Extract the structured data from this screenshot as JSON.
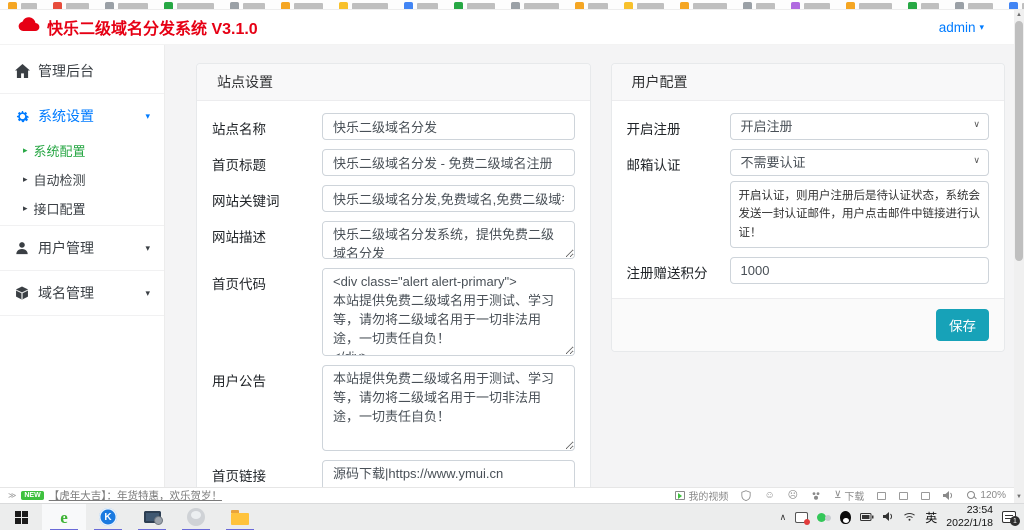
{
  "header": {
    "title": "快乐二级域名分发系统 V3.1.0",
    "user_menu": "admin"
  },
  "sidebar": {
    "home": "管理后台",
    "system_settings": "系统设置",
    "system_submenu": [
      "系统配置",
      "自动检测",
      "接口配置"
    ],
    "user_management": "用户管理",
    "domain_management": "域名管理"
  },
  "site_panel": {
    "title": "站点设置",
    "site_name_label": "站点名称",
    "site_name_value": "快乐二级域名分发",
    "home_title_label": "首页标题",
    "home_title_value": "快乐二级域名分发 - 免费二级域名注册",
    "keywords_label": "网站关键词",
    "keywords_value": "快乐二级域名分发,免费域名,免费二级域名,免费备案域名",
    "description_label": "网站描述",
    "description_value": "快乐二级域名分发系统，提供免费二级域名分发",
    "home_code_label": "首页代码",
    "home_code_value": "<div class=\"alert alert-primary\">\n本站提供免费二级域名用于测试、学习等，请勿将二级域名用于一切非法用途，一切责任自负！\n</div>",
    "notice_label": "用户公告",
    "notice_value": "本站提供免费二级域名用于测试、学习等，请勿将二级域名用于一切非法用途，一切责任自负！",
    "links_label": "首页链接",
    "links_value": "源码下载|https://www.ymui.cn"
  },
  "user_panel": {
    "title": "用户配置",
    "register_label": "开启注册",
    "register_value": "开启注册",
    "email_auth_label": "邮箱认证",
    "email_auth_value": "不需要认证",
    "email_auth_help": "开启认证，则用户注册后是待认证状态，系统会发送一封认证邮件，用户点击邮件中链接进行认证！",
    "points_label": "注册赠送积分",
    "points_value": "1000",
    "save_label": "保存"
  },
  "status_bar": {
    "badge": "NEW",
    "notice": "【虎年大吉】：年货特惠，欢乐贺岁！",
    "my_video": "我的视频",
    "download": "下载",
    "zoom_level": "120%"
  },
  "taskbar": {
    "ime": "英",
    "time": "23:54",
    "date": "2022/1/18",
    "notification_count": "1"
  },
  "bookmarks_strip": {
    "favicon_colors": [
      "#f5a623",
      "#e74c3c",
      "#9aa0a6",
      "#27a844",
      "#9aa0a6",
      "#f5a623",
      "#f8c12c",
      "#4285f4",
      "#27a844",
      "#9aa0a6",
      "#f5a623",
      "#f8c12c",
      "#f5a623",
      "#9aa0a6",
      "#b06ae0",
      "#f5a623",
      "#27a844",
      "#9aa0a6",
      "#4285f4",
      "#9aa0a6",
      "#f8c12c",
      "#e8711a"
    ]
  },
  "colors": {
    "brand_red": "#e60014",
    "link_blue": "#007bff",
    "active_green": "#28a745",
    "save_teal": "#17a2b8"
  }
}
